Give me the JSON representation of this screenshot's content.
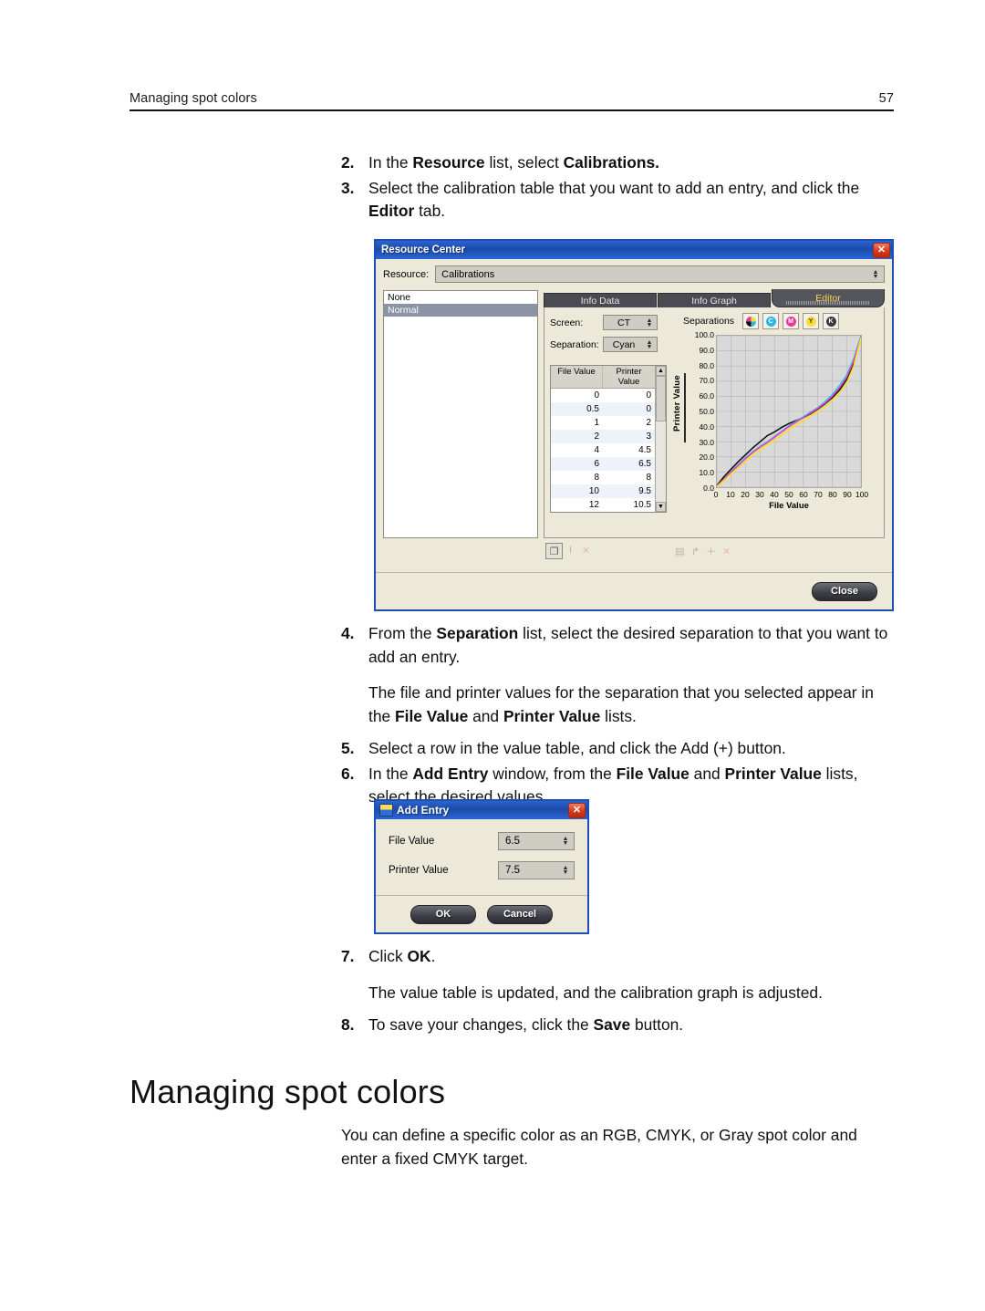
{
  "header": {
    "running_head": "Managing spot colors",
    "page_number": "57"
  },
  "steps_top": [
    {
      "num": "2.",
      "html": "In the <b>Resource</b> list, select <b>Calibrations.</b>"
    },
    {
      "num": "3.",
      "html": "Select the calibration table that you want to add an entry, and click the <b>Editor</b> tab."
    }
  ],
  "steps_mid": [
    {
      "num": "4.",
      "html": "From the <b>Separation</b> list, select the desired separation to that you want to add an entry."
    },
    {
      "num": "",
      "html": "The file and printer values for the separation that you selected appear in the <b>File Value</b> and <b>Printer Value</b> lists."
    },
    {
      "num": "5.",
      "html": "Select a row in the value table, and click the Add (+) button."
    },
    {
      "num": "6.",
      "html": "In the <b>Add Entry</b> window, from the <b>File Value</b> and <b>Printer Value</b> lists, select the desired values."
    }
  ],
  "steps_bottom": [
    {
      "num": "7.",
      "html": "Click <b>OK</b>."
    },
    {
      "num": "",
      "html": "The value table is updated, and the calibration graph is adjusted."
    },
    {
      "num": "8.",
      "html": "To save your changes, click the <b>Save</b> button."
    }
  ],
  "section": {
    "heading": "Managing spot colors",
    "body": "You can define a specific color as an RGB, CMYK, or Gray spot color and enter a fixed CMYK target."
  },
  "resource_center": {
    "title": "Resource Center",
    "close_glyph": "✕",
    "resource_label": "Resource:",
    "resource_value": "Calibrations",
    "list_items": [
      {
        "label": "None",
        "selected": false
      },
      {
        "label": "Normal",
        "selected": true
      }
    ],
    "tabs": [
      {
        "label": "Info Data",
        "active": false
      },
      {
        "label": "Info Graph",
        "active": false
      },
      {
        "label": "Editor",
        "active": true
      }
    ],
    "screen_label": "Screen:",
    "screen_value": "CT",
    "separation_label": "Separation:",
    "separation_value": "Cyan",
    "table": {
      "columns": [
        "File Value",
        "Printer Value"
      ],
      "rows": [
        [
          "0",
          "0"
        ],
        [
          "0.5",
          "0"
        ],
        [
          "1",
          "2"
        ],
        [
          "2",
          "3"
        ],
        [
          "4",
          "4.5"
        ],
        [
          "6",
          "6.5"
        ],
        [
          "8",
          "8"
        ],
        [
          "10",
          "9.5"
        ],
        [
          "12",
          "10.5"
        ]
      ]
    },
    "separations_label": "Separations",
    "separation_buttons": [
      {
        "name": "all",
        "glyph": "",
        "color": "#ffffff"
      },
      {
        "name": "cyan",
        "glyph": "C",
        "color": "#29b7e8"
      },
      {
        "name": "magenta",
        "glyph": "M",
        "color": "#e8399a"
      },
      {
        "name": "yellow",
        "glyph": "Y",
        "color": "#f2e033"
      },
      {
        "name": "black",
        "glyph": "K",
        "color": "#3a3a3a"
      }
    ],
    "toolbar_left": [
      {
        "name": "duplicate",
        "glyph": "❐",
        "enabled": true
      },
      {
        "name": "rename",
        "glyph": "I",
        "enabled": false
      },
      {
        "name": "delete",
        "glyph": "✕",
        "enabled": false,
        "red": true
      }
    ],
    "toolbar_right": [
      {
        "name": "save",
        "glyph": "▤",
        "enabled": false
      },
      {
        "name": "import",
        "glyph": "↱",
        "enabled": false
      },
      {
        "name": "add",
        "glyph": "＋",
        "enabled": false
      },
      {
        "name": "remove",
        "glyph": "✕",
        "enabled": false,
        "red": true
      }
    ],
    "close_button": "Close"
  },
  "add_entry": {
    "title": "Add Entry",
    "close_glyph": "✕",
    "file_value_label": "File Value",
    "file_value": "6.5",
    "printer_value_label": "Printer Value",
    "printer_value": "7.5",
    "ok_label": "OK",
    "cancel_label": "Cancel"
  },
  "chart_data": {
    "type": "line",
    "title": "",
    "xlabel": "File Value",
    "ylabel": "Printer Value",
    "xlim": [
      0,
      100
    ],
    "ylim": [
      0,
      100
    ],
    "xticks": [
      0,
      10,
      20,
      30,
      40,
      50,
      60,
      70,
      80,
      90,
      100
    ],
    "yticks": [
      "0.0",
      "10.0",
      "20.0",
      "30.0",
      "40.0",
      "50.0",
      "60.0",
      "70.0",
      "80.0",
      "90.0",
      "100.0"
    ],
    "grid": true,
    "legend": "none",
    "x": [
      0,
      5,
      10,
      15,
      20,
      25,
      30,
      35,
      40,
      45,
      50,
      55,
      60,
      65,
      70,
      75,
      80,
      85,
      90,
      95,
      100
    ],
    "series": [
      {
        "name": "Black",
        "color": "#111111",
        "values": [
          1,
          7,
          12,
          17,
          21.5,
          26,
          30,
          34,
          36.5,
          39.5,
          42,
          44,
          46,
          48.5,
          51.5,
          55,
          59,
          64,
          71,
          82,
          99.5
        ]
      },
      {
        "name": "Cyan",
        "color": "#2ad3ee",
        "values": [
          0.5,
          5.5,
          10.5,
          15,
          19.5,
          23.5,
          27,
          30,
          33.5,
          37,
          40.5,
          43.5,
          46.5,
          49.5,
          52.5,
          56.5,
          61,
          67,
          74,
          85,
          100
        ]
      },
      {
        "name": "Magenta",
        "color": "#ee3ab5",
        "values": [
          0.5,
          5.5,
          10,
          14.5,
          19,
          23,
          26.5,
          29.5,
          33,
          36.5,
          40,
          43,
          46,
          49,
          52,
          55.5,
          60,
          65.5,
          72.5,
          83.5,
          99
        ]
      },
      {
        "name": "Yellow",
        "color": "#f5e21f",
        "values": [
          0.3,
          4.5,
          9,
          13,
          17,
          21,
          24.5,
          28,
          31,
          34.5,
          38,
          41,
          44,
          47,
          50,
          53,
          57,
          62,
          68.5,
          80,
          98.5
        ]
      }
    ]
  }
}
